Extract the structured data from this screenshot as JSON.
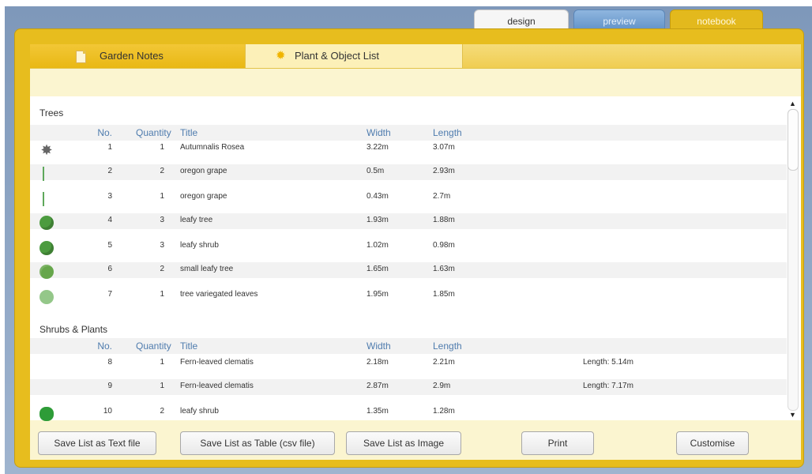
{
  "top_tabs": {
    "design": "design",
    "preview": "preview",
    "notebook": "notebook"
  },
  "sub_tabs": {
    "notes": "Garden Notes",
    "plant_list": "Plant & Object List"
  },
  "sections": [
    {
      "title": "Trees",
      "headers": [
        "No.",
        "Quantity",
        "Title",
        "Width",
        "Length"
      ],
      "rows": [
        {
          "no": "1",
          "quantity": "1",
          "title": "Autumnalis Rosea",
          "width": "3.22m",
          "length": "3.07m",
          "icon": "rose-icon"
        },
        {
          "no": "2",
          "quantity": "2",
          "title": "oregon grape",
          "width": "0.5m",
          "length": "2.93m",
          "icon": "stem-icon"
        },
        {
          "no": "3",
          "quantity": "1",
          "title": "oregon grape",
          "width": "0.43m",
          "length": "2.7m",
          "icon": "stem-icon"
        },
        {
          "no": "4",
          "quantity": "3",
          "title": "leafy tree",
          "width": "1.93m",
          "length": "1.88m",
          "icon": "leafy-tree-icon"
        },
        {
          "no": "5",
          "quantity": "3",
          "title": "leafy shrub",
          "width": "1.02m",
          "length": "0.98m",
          "icon": "leafy-shrub-icon"
        },
        {
          "no": "6",
          "quantity": "2",
          "title": "small leafy tree",
          "width": "1.65m",
          "length": "1.63m",
          "icon": "small-leafy-tree-icon"
        },
        {
          "no": "7",
          "quantity": "1",
          "title": "tree variegated leaves",
          "width": "1.95m",
          "length": "1.85m",
          "icon": "variegated-tree-icon"
        }
      ]
    },
    {
      "title": "Shrubs & Plants",
      "headers": [
        "No.",
        "Quantity",
        "Title",
        "Width",
        "Length"
      ],
      "rows": [
        {
          "no": "8",
          "quantity": "1",
          "title": "Fern-leaved clematis",
          "width": "2.18m",
          "length": "2.21m",
          "note": "Length: 5.14m",
          "icon": ""
        },
        {
          "no": "9",
          "quantity": "1",
          "title": "Fern-leaved clematis",
          "width": "2.87m",
          "length": "2.9m",
          "note": "Length: 7.17m",
          "icon": ""
        },
        {
          "no": "10",
          "quantity": "2",
          "title": "leafy shrub",
          "width": "1.35m",
          "length": "1.28m",
          "icon": "shrub-icon"
        }
      ]
    }
  ],
  "buttons": {
    "save_text": "Save List as Text file",
    "save_csv": "Save List as Table (csv file)",
    "save_image": "Save List as Image",
    "print": "Print",
    "customise": "Customise"
  }
}
